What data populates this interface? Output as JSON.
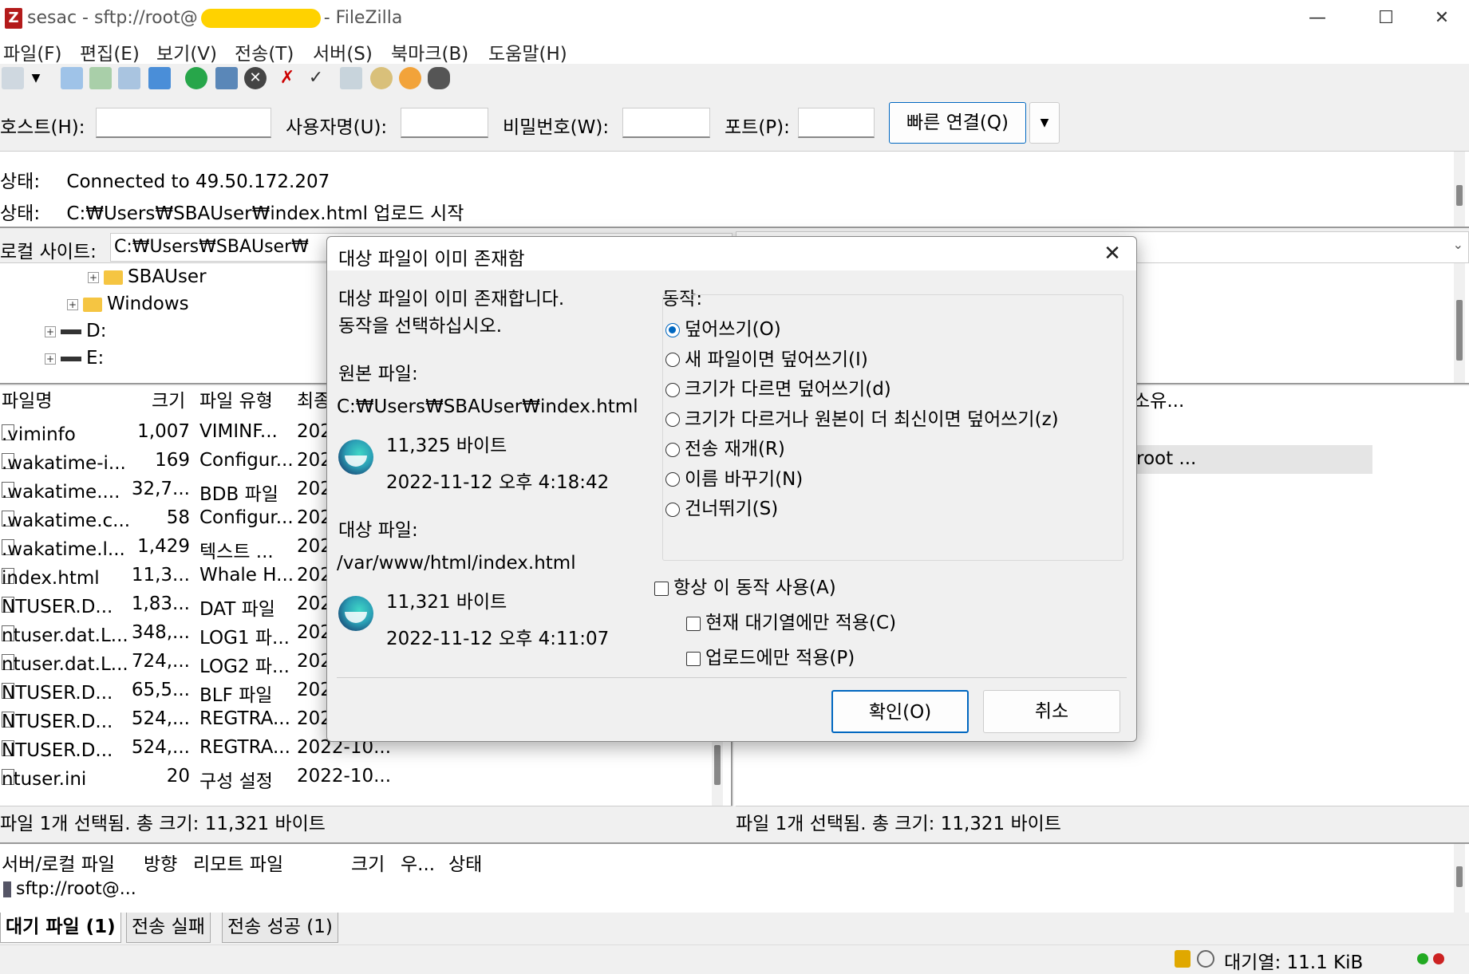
{
  "window": {
    "title_prefix": "sesac - sftp://root@",
    "title_suffix": "- FileZilla",
    "app_icon": "Z",
    "controls": {
      "minimize": "—",
      "maximize": "☐",
      "close": "✕"
    }
  },
  "menu": [
    "파일(F)",
    "편집(E)",
    "보기(V)",
    "전송(T)",
    "서버(S)",
    "북마크(B)",
    "도움말(H)"
  ],
  "quickconnect": {
    "host_label": "호스트(H):",
    "user_label": "사용자명(U):",
    "pass_label": "비밀번호(W):",
    "port_label": "포트(P):",
    "host_value": "",
    "user_value": "",
    "pass_value": "",
    "port_value": "",
    "connect_button": "빠른 연결(Q)",
    "dropdown": "▼"
  },
  "log": [
    {
      "label": "상태:",
      "text": "Connected to 49.50.172.207"
    },
    {
      "label": "상태:",
      "text": "C:₩Users₩SBAUser₩index.html 업로드 시작"
    }
  ],
  "local": {
    "site_label": "로컬 사이트:",
    "site_path": "C:₩Users₩SBAUser₩",
    "tree": [
      {
        "label": "SBAUser",
        "kind": "folder"
      },
      {
        "label": "Windows",
        "kind": "folder"
      },
      {
        "label": "D:",
        "kind": "drive"
      },
      {
        "label": "E:",
        "kind": "drive"
      }
    ],
    "columns": [
      "파일명",
      "크기",
      "파일 유형",
      "최종"
    ],
    "files": [
      {
        "name": ".viminfo",
        "size": "1,007",
        "type": "VIMINF...",
        "date": "202"
      },
      {
        "name": ".wakatime-i...",
        "size": "169",
        "type": "Configur...",
        "date": "202"
      },
      {
        "name": ".wakatime....",
        "size": "32,7...",
        "type": "BDB 파일",
        "date": "202"
      },
      {
        "name": ".wakatime.c...",
        "size": "58",
        "type": "Configur...",
        "date": "202"
      },
      {
        "name": ".wakatime.l...",
        "size": "1,429",
        "type": "텍스트 ...",
        "date": "202"
      },
      {
        "name": "index.html",
        "size": "11,3...",
        "type": "Whale H...",
        "date": "202"
      },
      {
        "name": "NTUSER.D...",
        "size": "1,83...",
        "type": "DAT 파일",
        "date": "202"
      },
      {
        "name": "ntuser.dat.L...",
        "size": "348,...",
        "type": "LOG1 파...",
        "date": "202"
      },
      {
        "name": "ntuser.dat.L...",
        "size": "724,...",
        "type": "LOG2 파...",
        "date": "202"
      },
      {
        "name": "NTUSER.D...",
        "size": "65,5...",
        "type": "BLF 파일",
        "date": "202"
      },
      {
        "name": "NTUSER.D...",
        "size": "524,...",
        "type": "REGTRA...",
        "date": "202"
      },
      {
        "name": "NTUSER.D...",
        "size": "524,...",
        "type": "REGTRA...",
        "date": "2022-10..."
      },
      {
        "name": "ntuser.ini",
        "size": "20",
        "type": "구성 설정",
        "date": "2022-10..."
      }
    ],
    "selection_status": "파일 1개 선택됨. 총 크기: 11,321 바이트"
  },
  "remote": {
    "col_fragment": "소유...",
    "row_fragment": "root ...",
    "selection_status": "파일 1개 선택됨. 총 크기: 11,321 바이트"
  },
  "queue": {
    "columns": [
      "서버/로컬 파일",
      "방향",
      "리모트 파일",
      "크기",
      "우...",
      "상태"
    ],
    "row": "sftp://root@...",
    "tabs": [
      "대기 파일 (1)",
      "전송 실패",
      "전송 성공 (1)"
    ]
  },
  "statusbar": {
    "queue": "대기열: 11.1 KiB"
  },
  "dialog": {
    "title": "대상 파일이 이미 존재함",
    "message_line1": "대상 파일이 이미 존재합니다.",
    "message_line2": "동작을 선택하십시오.",
    "source_label": "원본 파일:",
    "source_path": "C:₩Users₩SBAUser₩index.html",
    "source_size": "11,325 바이트",
    "source_date": "2022-11-12 오후 4:18:42",
    "target_label": "대상 파일:",
    "target_path": "/var/www/html/index.html",
    "target_size": "11,321 바이트",
    "target_date": "2022-11-12 오후 4:11:07",
    "action_label": "동작:",
    "options": [
      "덮어쓰기(O)",
      "새 파일이면 덮어쓰기(I)",
      "크기가 다르면 덮어쓰기(d)",
      "크기가 다르거나 원본이 더 최신이면 덮어쓰기(z)",
      "전송 재개(R)",
      "이름 바꾸기(N)",
      "건너뛰기(S)"
    ],
    "selected_option": 0,
    "always_use": "항상 이 동작 사용(A)",
    "queue_only": "현재 대기열에만 적용(C)",
    "upload_only": "업로드에만 적용(P)",
    "ok": "확인(O)",
    "cancel": "취소",
    "close": "✕"
  }
}
